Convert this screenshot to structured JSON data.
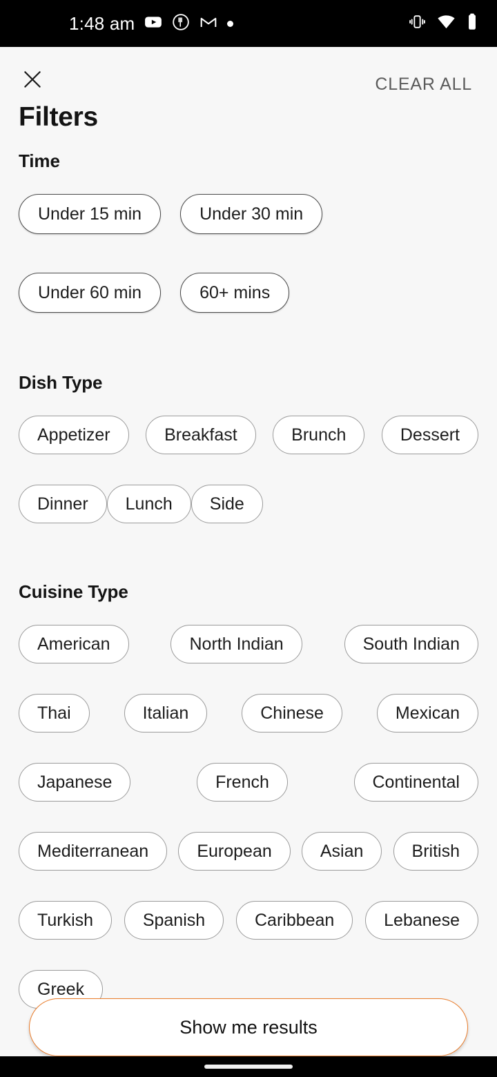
{
  "status_bar": {
    "time": "1:48 am",
    "left_icons": [
      "youtube-icon",
      "fork-circle-icon",
      "gmail-icon",
      "dot-icon"
    ],
    "right_icons": [
      "vibrate-icon",
      "wifi-icon",
      "battery-icon"
    ],
    "background_color": "#000000",
    "foreground_color": "#FFFFFF"
  },
  "header": {
    "close_icon": "close-icon",
    "clear_all_label": "CLEAR ALL",
    "title": "Filters",
    "clear_all_color": "#5B5B5B"
  },
  "sections": [
    {
      "id": "time",
      "title": "Time",
      "chips": [
        "Under 15 min",
        "Under 30 min",
        "Under 60 min",
        "60+ mins"
      ]
    },
    {
      "id": "dish-type",
      "title": "Dish Type",
      "chips": [
        "Appetizer",
        "Breakfast",
        "Brunch",
        "Dessert",
        "Dinner",
        "Lunch",
        "Side"
      ]
    },
    {
      "id": "cuisine-type",
      "title": "Cuisine Type",
      "chips": [
        "American",
        "North Indian",
        "South Indian",
        "Thai",
        "Italian",
        "Chinese",
        "Mexican",
        "Japanese",
        "French",
        "Continental",
        "Mediterranean",
        "European",
        "Asian",
        "British",
        "Turkish",
        "Spanish",
        "Caribbean",
        "Lebanese",
        "Greek"
      ]
    }
  ],
  "footer": {
    "submit_label": "Show me results",
    "accent_color": "#EA7C2A"
  },
  "nav_bar": {
    "handle": "home-gesture-handle"
  },
  "theme": {
    "page_background": "#F7F7F7",
    "chip_background": "#FFFFFF",
    "text_primary": "#141414"
  }
}
